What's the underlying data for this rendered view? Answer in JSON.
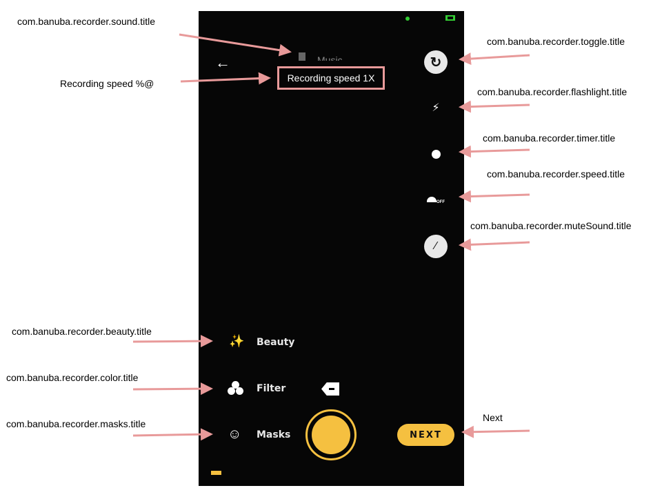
{
  "annotations": {
    "sound": "com.banuba.recorder.sound.title",
    "speed_format": "Recording speed %@",
    "toggle": "com.banuba.recorder.toggle.title",
    "flashlight": "com.banuba.recorder.flashlight.title",
    "timer": "com.banuba.recorder.timer.title",
    "speed": "com.banuba.recorder.speed.title",
    "mute": "com.banuba.recorder.muteSound.title",
    "beauty": "com.banuba.recorder.beauty.title",
    "color": "com.banuba.recorder.color.title",
    "masks": "com.banuba.recorder.masks.title",
    "next": "Next"
  },
  "screen": {
    "music_label": "Music",
    "speed_toast": "Recording speed 1X",
    "speed_off": "OFF",
    "beauty": "Beauty",
    "filter": "Filter",
    "masks": "Masks",
    "next": "NEXT"
  },
  "colors": {
    "accent": "#f5c040",
    "arrow": "#e89a9a",
    "background": "#060606"
  }
}
